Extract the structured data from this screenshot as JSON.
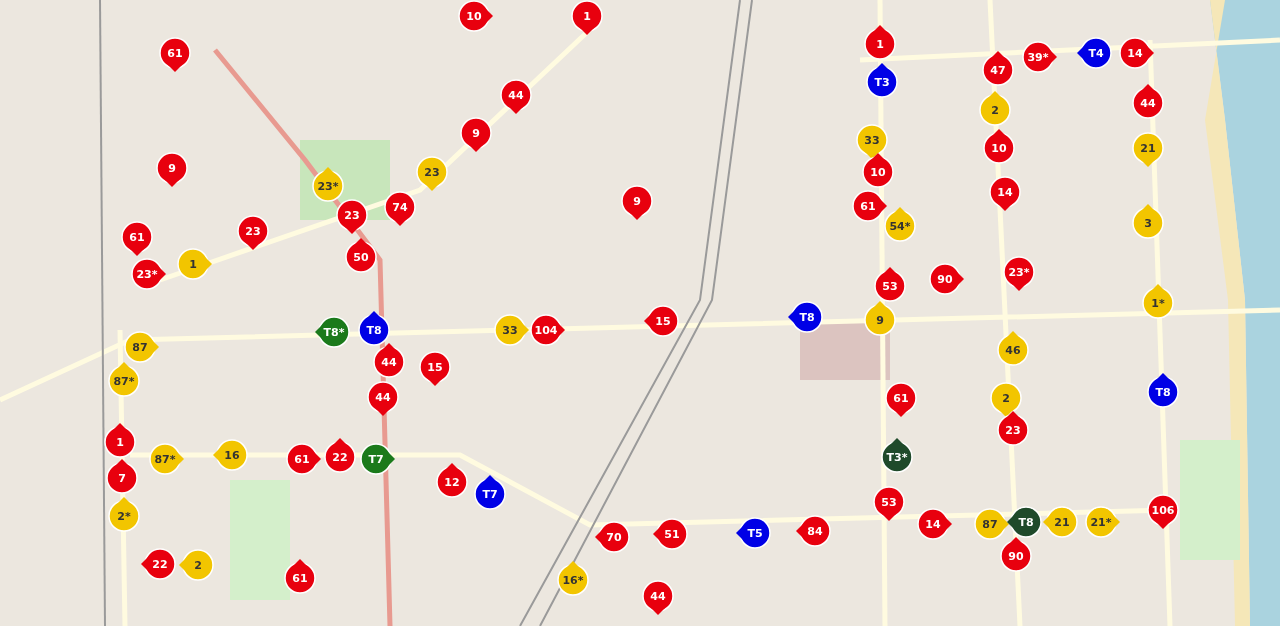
{
  "map": {
    "markers": [
      {
        "label": "10",
        "color": "#e8000e"
      },
      {
        "label": "1",
        "color": "#e8000e"
      },
      {
        "label": "61",
        "color": "#e8000e"
      },
      {
        "label": "44",
        "color": "#e8000e"
      },
      {
        "label": "9",
        "color": "#e8000e"
      },
      {
        "label": "9",
        "color": "#e8000e"
      },
      {
        "label": "23",
        "color": "#f2c500"
      },
      {
        "label": "23*",
        "color": "#f2c500"
      },
      {
        "label": "23",
        "color": "#e8000e"
      },
      {
        "label": "23",
        "color": "#e8000e"
      },
      {
        "label": "74",
        "color": "#e8000e"
      },
      {
        "label": "50",
        "color": "#e8000e"
      },
      {
        "label": "61",
        "color": "#e8000e"
      },
      {
        "label": "1",
        "color": "#f2c500"
      },
      {
        "label": "23*",
        "color": "#e8000e"
      },
      {
        "label": "9",
        "color": "#e8000e"
      },
      {
        "label": "1",
        "color": "#e8000e"
      },
      {
        "label": "T3",
        "color": "#0000e6"
      },
      {
        "label": "47",
        "color": "#e8000e"
      },
      {
        "label": "39*",
        "color": "#e8000e"
      },
      {
        "label": "T4",
        "color": "#0000e6"
      },
      {
        "label": "14",
        "color": "#e8000e"
      },
      {
        "label": "2",
        "color": "#f2c500"
      },
      {
        "label": "10",
        "color": "#e8000e"
      },
      {
        "label": "44",
        "color": "#e8000e"
      },
      {
        "label": "21",
        "color": "#f2c500"
      },
      {
        "label": "33",
        "color": "#f2c500"
      },
      {
        "label": "10",
        "color": "#e8000e"
      },
      {
        "label": "61",
        "color": "#e8000e"
      },
      {
        "label": "54*",
        "color": "#f2c500"
      },
      {
        "label": "14",
        "color": "#e8000e"
      },
      {
        "label": "3",
        "color": "#f2c500"
      },
      {
        "label": "90",
        "color": "#e8000e"
      },
      {
        "label": "23*",
        "color": "#e8000e"
      },
      {
        "label": "1*",
        "color": "#f2c500"
      },
      {
        "label": "53",
        "color": "#e8000e"
      },
      {
        "label": "33",
        "color": "#f2c500"
      },
      {
        "label": "104",
        "color": "#e8000e"
      },
      {
        "label": "15",
        "color": "#e8000e"
      },
      {
        "label": "T8",
        "color": "#0000e6"
      },
      {
        "label": "9",
        "color": "#f2c500"
      },
      {
        "label": "46",
        "color": "#f2c500"
      },
      {
        "label": "T8*",
        "color": "#1b7a1b"
      },
      {
        "label": "T8",
        "color": "#0000e6"
      },
      {
        "label": "44",
        "color": "#e8000e"
      },
      {
        "label": "15",
        "color": "#e8000e"
      },
      {
        "label": "44",
        "color": "#e8000e"
      },
      {
        "label": "87",
        "color": "#f2c500"
      },
      {
        "label": "87*",
        "color": "#f2c500"
      },
      {
        "label": "1",
        "color": "#e8000e"
      },
      {
        "label": "7",
        "color": "#e8000e"
      },
      {
        "label": "2*",
        "color": "#f2c500"
      },
      {
        "label": "87*",
        "color": "#f2c500"
      },
      {
        "label": "16",
        "color": "#f2c500"
      },
      {
        "label": "61",
        "color": "#e8000e"
      },
      {
        "label": "22",
        "color": "#e8000e"
      },
      {
        "label": "T7",
        "color": "#1b7a1b"
      },
      {
        "label": "12",
        "color": "#e8000e"
      },
      {
        "label": "T7",
        "color": "#0000e6"
      },
      {
        "label": "22",
        "color": "#e8000e"
      },
      {
        "label": "2",
        "color": "#f2c500"
      },
      {
        "label": "61",
        "color": "#e8000e"
      },
      {
        "label": "16*",
        "color": "#f2c500"
      },
      {
        "label": "70",
        "color": "#e8000e"
      },
      {
        "label": "51",
        "color": "#e8000e"
      },
      {
        "label": "T5",
        "color": "#0000e6"
      },
      {
        "label": "84",
        "color": "#e8000e"
      },
      {
        "label": "44",
        "color": "#e8000e"
      },
      {
        "label": "53",
        "color": "#e8000e"
      },
      {
        "label": "14",
        "color": "#e8000e"
      },
      {
        "label": "61",
        "color": "#e8000e"
      },
      {
        "label": "T3*",
        "color": "#1f4a2a"
      },
      {
        "label": "2",
        "color": "#f2c500"
      },
      {
        "label": "23",
        "color": "#e8000e"
      },
      {
        "label": "T8",
        "color": "#0000e6"
      },
      {
        "label": "87",
        "color": "#f2c500"
      },
      {
        "label": "T8",
        "color": "#1f4a2a"
      },
      {
        "label": "90",
        "color": "#e8000e"
      },
      {
        "label": "21",
        "color": "#f2c500"
      },
      {
        "label": "21*",
        "color": "#f2c500"
      },
      {
        "label": "106",
        "color": "#e8000e"
      }
    ]
  }
}
